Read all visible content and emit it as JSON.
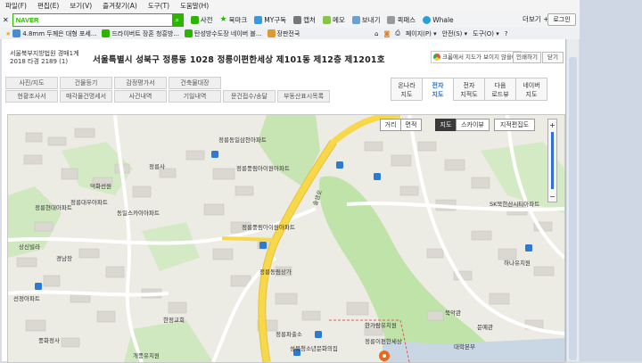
{
  "menu": [
    "파일(F)",
    "편집(E)",
    "보기(V)",
    "즐겨찾기(A)",
    "도구(T)",
    "도움말(H)"
  ],
  "toolbar": {
    "naver_logo": "NAVER",
    "search_placeholder": "",
    "items": [
      "사전",
      "북마크",
      "MY구독",
      "캡처",
      "메모",
      "보내기",
      "퀵패스",
      "Whale"
    ],
    "more": "더보기 +",
    "login": "로그인"
  },
  "favorites": [
    "4.8mm 두께은 대형 포세...",
    "드라이버트 장혼 청흥방...",
    "탄성방수도장 네이버 블...",
    "장판전국"
  ],
  "favright": [
    "페이지(P) ▾",
    "안전(S) ▾",
    "도구(O) ▾",
    "?"
  ],
  "court": {
    "line1": "서울북부지방법원 경매1계",
    "line2": "2018 타경 2189 (1)"
  },
  "address": "서울특별시 성북구 정릉동 1028 정릉이편한세상 제101동 제12층 제1201호",
  "notice": "크롬에서 지도가 보이지 않을때",
  "print_btn": "인쇄하기",
  "close_btn": "닫기",
  "buttons_row1": [
    "사진/지도",
    "건물등기",
    "감정평가서",
    "건축물대장"
  ],
  "buttons_row2": [
    "현황조사서",
    "매각물건명세서",
    "사건내역",
    "기일내역",
    "문건접수/송달",
    "부동산표시목록"
  ],
  "map_tabs": [
    {
      "l1": "온나라",
      "l2": "지도"
    },
    {
      "l1": "전자",
      "l2": "지도"
    },
    {
      "l1": "전자",
      "l2": "지적도"
    },
    {
      "l1": "다음",
      "l2": "로드뷰"
    },
    {
      "l1": "네이버",
      "l2": "지도"
    }
  ],
  "map_controls": {
    "distance": "거리",
    "area": "면적",
    "map": "지도",
    "skyview": "스카이뷰",
    "cadastral": "지적편집도"
  },
  "map_labels": [
    "정릉사",
    "덕화선원",
    "정릉대우아파트",
    "동일스카이아파트",
    "정릉현대아파트",
    "상신빌라",
    "경남장",
    "선정아파트",
    "풍화정사",
    "한정교회",
    "개풍유치원",
    "경희유치원",
    "정릉동일삼천아파트",
    "정릉풍림아이원아파트",
    "정릉풍림아이원아파트",
    "정릉동림상가",
    "정릉초교",
    "정릉파출소",
    "성북청소년문화의집",
    "한가람유치원",
    "정릉이편한세상",
    "SK북한산시티아파트",
    "하나유치원",
    "북악관",
    "문예관",
    "정릉로",
    "대학본부",
    "중앙",
    "솔샘로"
  ],
  "colors": {
    "road_yellow": "#f6d84a",
    "park_green": "#bfe3a9",
    "marker": "#e86a1e",
    "accent": "#1a6bc9"
  }
}
